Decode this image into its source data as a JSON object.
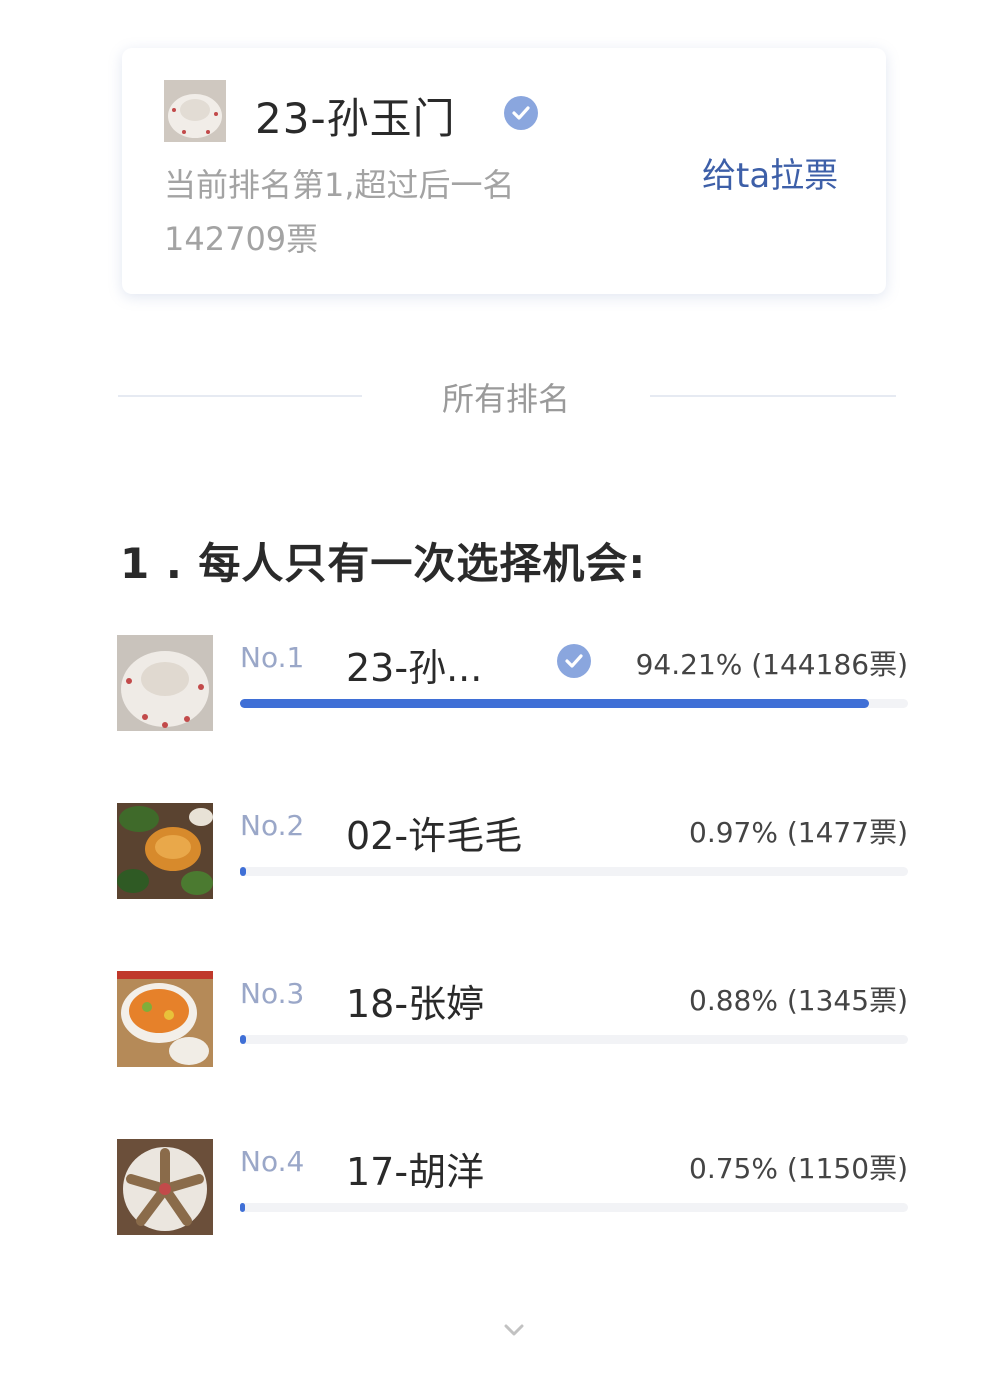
{
  "card": {
    "name": "23-孙玉门",
    "rank_text": "当前排名第1,超过后一名",
    "lead_votes": "142709票",
    "vote_button": "给ta拉票"
  },
  "divider": {
    "label": "所有排名"
  },
  "question": "1 . 每人只有一次选择机会:",
  "rankings": [
    {
      "rank": "No.1",
      "name": "23-孙...",
      "percent_text": "94.21% (144186票)",
      "percent": 94.21,
      "verified": true
    },
    {
      "rank": "No.2",
      "name": "02-许毛毛",
      "percent_text": "0.97% (1477票)",
      "percent": 0.97,
      "verified": false
    },
    {
      "rank": "No.3",
      "name": "18-张婷",
      "percent_text": "0.88% (1345票)",
      "percent": 0.88,
      "verified": false
    },
    {
      "rank": "No.4",
      "name": "17-胡洋",
      "percent_text": "0.75% (1150票)",
      "percent": 0.75,
      "verified": false
    }
  ],
  "colors": {
    "accent": "#3f6fd6",
    "link": "#3d5fa8",
    "verified": "#8aa6de",
    "muted": "#a3a3a3"
  },
  "icons": {
    "verified": "verified-check-icon",
    "more": "chevron-down-icon"
  }
}
